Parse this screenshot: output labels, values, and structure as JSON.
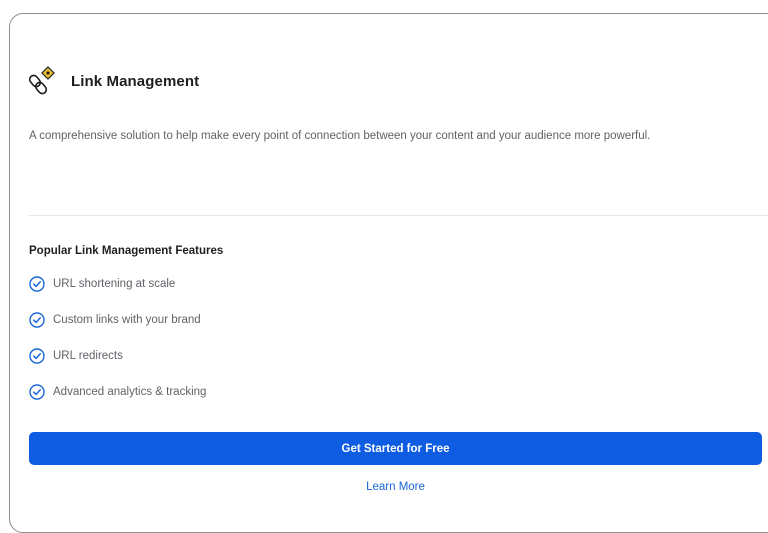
{
  "card": {
    "icon": "link-management-icon",
    "title": "Link Management",
    "description": "A comprehensive solution to help make every point of connection between your content and your audience more powerful.",
    "features_heading": "Popular Link Management Features",
    "features": [
      {
        "icon": "check-circle-icon",
        "label": "URL shortening at scale"
      },
      {
        "icon": "check-circle-icon",
        "label": "Custom links with your brand"
      },
      {
        "icon": "check-circle-icon",
        "label": "URL redirects"
      },
      {
        "icon": "check-circle-icon",
        "label": "Advanced analytics & tracking"
      }
    ],
    "cta_label": "Get Started for Free",
    "secondary_link_label": "Learn More"
  },
  "colors": {
    "primary": "#0e5ce1",
    "link": "#1a66d8",
    "accent_yellow": "#f2c230",
    "text_dark": "#1d1d1d",
    "text_muted": "#5f6368"
  }
}
